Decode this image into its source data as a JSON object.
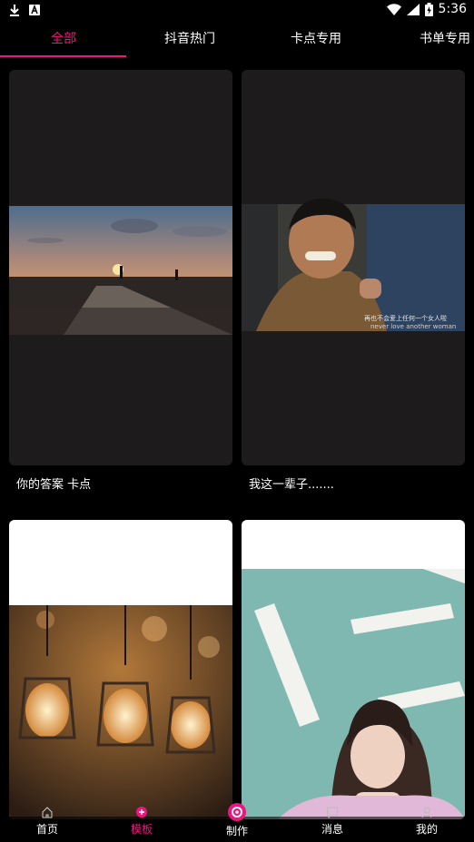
{
  "status_bar": {
    "time": "5:36",
    "left_icons": [
      "download-icon",
      "notification-app-icon"
    ],
    "right_icons": [
      "wifi-icon",
      "signal-icon",
      "battery-icon"
    ]
  },
  "tabs": [
    {
      "label": "全部",
      "active": true
    },
    {
      "label": "抖音热门",
      "active": false
    },
    {
      "label": "卡点专用",
      "active": false
    },
    {
      "label": "书单专用",
      "active": false
    }
  ],
  "accent_color": "#f0147f",
  "templates": [
    {
      "title": "你的答案  卡点",
      "scene": "sunset-silhouette"
    },
    {
      "title": "我这一辈子.......",
      "scene": "crying-man",
      "subtitle_cn": "再也不会爱上任何一个女人啦",
      "subtitle_en": "never love another woman"
    },
    {
      "title": "",
      "scene": "edison-bulbs"
    },
    {
      "title": "",
      "scene": "girl-portrait"
    }
  ],
  "bottom_nav": [
    {
      "label": "首页",
      "icon": "home-icon",
      "active": false
    },
    {
      "label": "模板",
      "icon": "template-icon",
      "active": true
    },
    {
      "label": "制作",
      "icon": "create-icon",
      "active": false
    },
    {
      "label": "消息",
      "icon": "message-icon",
      "active": false
    },
    {
      "label": "我的",
      "icon": "profile-icon",
      "active": false
    }
  ]
}
